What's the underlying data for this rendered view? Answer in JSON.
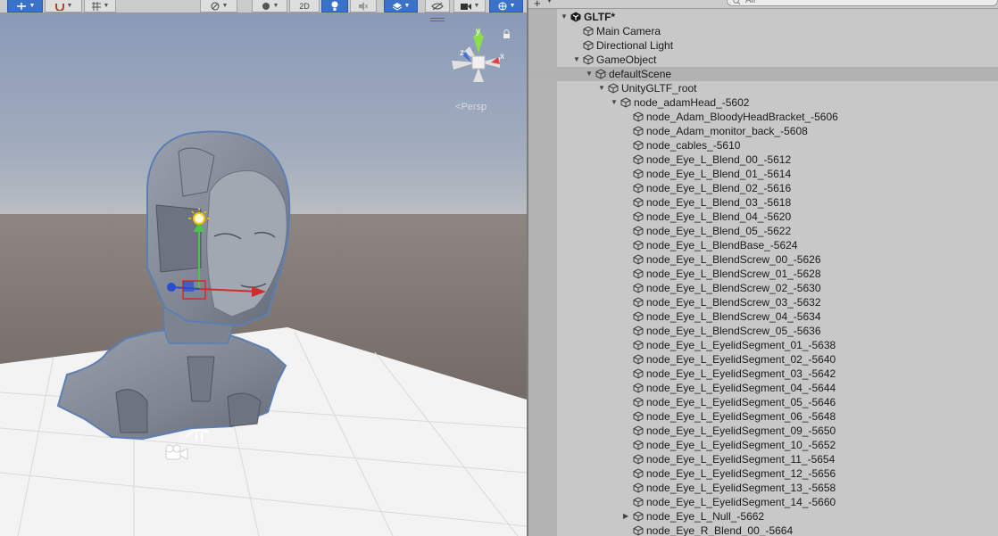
{
  "scene": {
    "toolbar": {
      "toggle_2d": "2D"
    },
    "persp_label": "Persp",
    "gizmo_axes": {
      "x": "x",
      "y": "y",
      "z": "z"
    }
  },
  "hierarchy": {
    "search_placeholder": "All",
    "items": [
      {
        "label": "GLTF*",
        "depth": 0,
        "arrow": "down",
        "icon": "unity-scene-icon",
        "bold": true
      },
      {
        "label": "Main Camera",
        "depth": 1,
        "arrow": "none",
        "icon": "gameobject-cube-icon"
      },
      {
        "label": "Directional Light",
        "depth": 1,
        "arrow": "none",
        "icon": "gameobject-cube-icon"
      },
      {
        "label": "GameObject",
        "depth": 1,
        "arrow": "down",
        "icon": "gameobject-cube-icon"
      },
      {
        "label": "defaultScene",
        "depth": 2,
        "arrow": "down",
        "icon": "gameobject-cube-icon",
        "selected": true
      },
      {
        "label": "UnityGLTF_root",
        "depth": 3,
        "arrow": "down",
        "icon": "gameobject-cube-icon"
      },
      {
        "label": "node_adamHead_-5602",
        "depth": 4,
        "arrow": "down",
        "icon": "gameobject-cube-icon"
      },
      {
        "label": "node_Adam_BloodyHeadBracket_-5606",
        "depth": 5,
        "arrow": "none",
        "icon": "gameobject-cube-icon"
      },
      {
        "label": "node_Adam_monitor_back_-5608",
        "depth": 5,
        "arrow": "none",
        "icon": "gameobject-cube-icon"
      },
      {
        "label": "node_cables_-5610",
        "depth": 5,
        "arrow": "none",
        "icon": "gameobject-cube-icon"
      },
      {
        "label": "node_Eye_L_Blend_00_-5612",
        "depth": 5,
        "arrow": "none",
        "icon": "gameobject-cube-icon"
      },
      {
        "label": "node_Eye_L_Blend_01_-5614",
        "depth": 5,
        "arrow": "none",
        "icon": "gameobject-cube-icon"
      },
      {
        "label": "node_Eye_L_Blend_02_-5616",
        "depth": 5,
        "arrow": "none",
        "icon": "gameobject-cube-icon"
      },
      {
        "label": "node_Eye_L_Blend_03_-5618",
        "depth": 5,
        "arrow": "none",
        "icon": "gameobject-cube-icon"
      },
      {
        "label": "node_Eye_L_Blend_04_-5620",
        "depth": 5,
        "arrow": "none",
        "icon": "gameobject-cube-icon"
      },
      {
        "label": "node_Eye_L_Blend_05_-5622",
        "depth": 5,
        "arrow": "none",
        "icon": "gameobject-cube-icon"
      },
      {
        "label": "node_Eye_L_BlendBase_-5624",
        "depth": 5,
        "arrow": "none",
        "icon": "gameobject-cube-icon"
      },
      {
        "label": "node_Eye_L_BlendScrew_00_-5626",
        "depth": 5,
        "arrow": "none",
        "icon": "gameobject-cube-icon"
      },
      {
        "label": "node_Eye_L_BlendScrew_01_-5628",
        "depth": 5,
        "arrow": "none",
        "icon": "gameobject-cube-icon"
      },
      {
        "label": "node_Eye_L_BlendScrew_02_-5630",
        "depth": 5,
        "arrow": "none",
        "icon": "gameobject-cube-icon"
      },
      {
        "label": "node_Eye_L_BlendScrew_03_-5632",
        "depth": 5,
        "arrow": "none",
        "icon": "gameobject-cube-icon"
      },
      {
        "label": "node_Eye_L_BlendScrew_04_-5634",
        "depth": 5,
        "arrow": "none",
        "icon": "gameobject-cube-icon"
      },
      {
        "label": "node_Eye_L_BlendScrew_05_-5636",
        "depth": 5,
        "arrow": "none",
        "icon": "gameobject-cube-icon"
      },
      {
        "label": "node_Eye_L_EyelidSegment_01_-5638",
        "depth": 5,
        "arrow": "none",
        "icon": "gameobject-cube-icon"
      },
      {
        "label": "node_Eye_L_EyelidSegment_02_-5640",
        "depth": 5,
        "arrow": "none",
        "icon": "gameobject-cube-icon"
      },
      {
        "label": "node_Eye_L_EyelidSegment_03_-5642",
        "depth": 5,
        "arrow": "none",
        "icon": "gameobject-cube-icon"
      },
      {
        "label": "node_Eye_L_EyelidSegment_04_-5644",
        "depth": 5,
        "arrow": "none",
        "icon": "gameobject-cube-icon"
      },
      {
        "label": "node_Eye_L_EyelidSegment_05_-5646",
        "depth": 5,
        "arrow": "none",
        "icon": "gameobject-cube-icon"
      },
      {
        "label": "node_Eye_L_EyelidSegment_06_-5648",
        "depth": 5,
        "arrow": "none",
        "icon": "gameobject-cube-icon"
      },
      {
        "label": "node_Eye_L_EyelidSegment_09_-5650",
        "depth": 5,
        "arrow": "none",
        "icon": "gameobject-cube-icon"
      },
      {
        "label": "node_Eye_L_EyelidSegment_10_-5652",
        "depth": 5,
        "arrow": "none",
        "icon": "gameobject-cube-icon"
      },
      {
        "label": "node_Eye_L_EyelidSegment_11_-5654",
        "depth": 5,
        "arrow": "none",
        "icon": "gameobject-cube-icon"
      },
      {
        "label": "node_Eye_L_EyelidSegment_12_-5656",
        "depth": 5,
        "arrow": "none",
        "icon": "gameobject-cube-icon"
      },
      {
        "label": "node_Eye_L_EyelidSegment_13_-5658",
        "depth": 5,
        "arrow": "none",
        "icon": "gameobject-cube-icon"
      },
      {
        "label": "node_Eye_L_EyelidSegment_14_-5660",
        "depth": 5,
        "arrow": "none",
        "icon": "gameobject-cube-icon"
      },
      {
        "label": "node_Eye_L_Null_-5662",
        "depth": 5,
        "arrow": "right",
        "icon": "gameobject-cube-icon"
      },
      {
        "label": "node_Eye_R_Blend_00_-5664",
        "depth": 5,
        "arrow": "none",
        "icon": "gameobject-cube-icon"
      }
    ]
  },
  "colors": {
    "sky": "#97a5c0",
    "ground": "#6e655f",
    "floor": "#f2f2f2",
    "model": "#8a919d",
    "selection_outline": "#5b7fb5",
    "toolbar_active": "#3a72c9",
    "hierarchy_bg": "#c8c8c8",
    "hierarchy_gutter": "#b3b3b3",
    "row_selected": "#b2b2b2"
  }
}
